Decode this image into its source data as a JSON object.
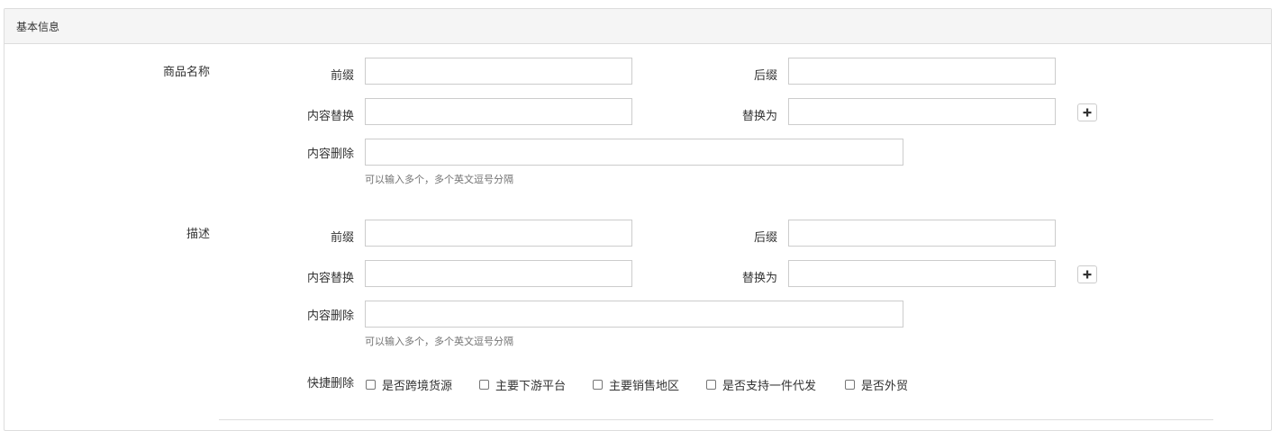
{
  "panel": {
    "title": "基本信息"
  },
  "product_name": {
    "section_label": "商品名称",
    "prefix_label": "前缀",
    "suffix_label": "后缀",
    "replace_label": "内容替换",
    "replace_with_label": "替换为",
    "delete_label": "内容删除",
    "help_text": "可以输入多个，多个英文逗号分隔",
    "prefix_value": "",
    "suffix_value": "",
    "replace_value": "",
    "replace_with_value": "",
    "delete_value": "",
    "add_icon": "plus-icon"
  },
  "description": {
    "section_label": "描述",
    "prefix_label": "前缀",
    "suffix_label": "后缀",
    "replace_label": "内容替换",
    "replace_with_label": "替换为",
    "delete_label": "内容删除",
    "help_text": "可以输入多个，多个英文逗号分隔",
    "prefix_value": "",
    "suffix_value": "",
    "replace_value": "",
    "replace_with_value": "",
    "delete_value": "",
    "add_icon": "plus-icon"
  },
  "quick_delete": {
    "label": "快捷删除",
    "options": [
      {
        "label": "是否跨境货源",
        "checked": false
      },
      {
        "label": "主要下游平台",
        "checked": false
      },
      {
        "label": "主要销售地区",
        "checked": false
      },
      {
        "label": "是否支持一件代发",
        "checked": false
      },
      {
        "label": "是否外贸",
        "checked": false
      }
    ]
  }
}
